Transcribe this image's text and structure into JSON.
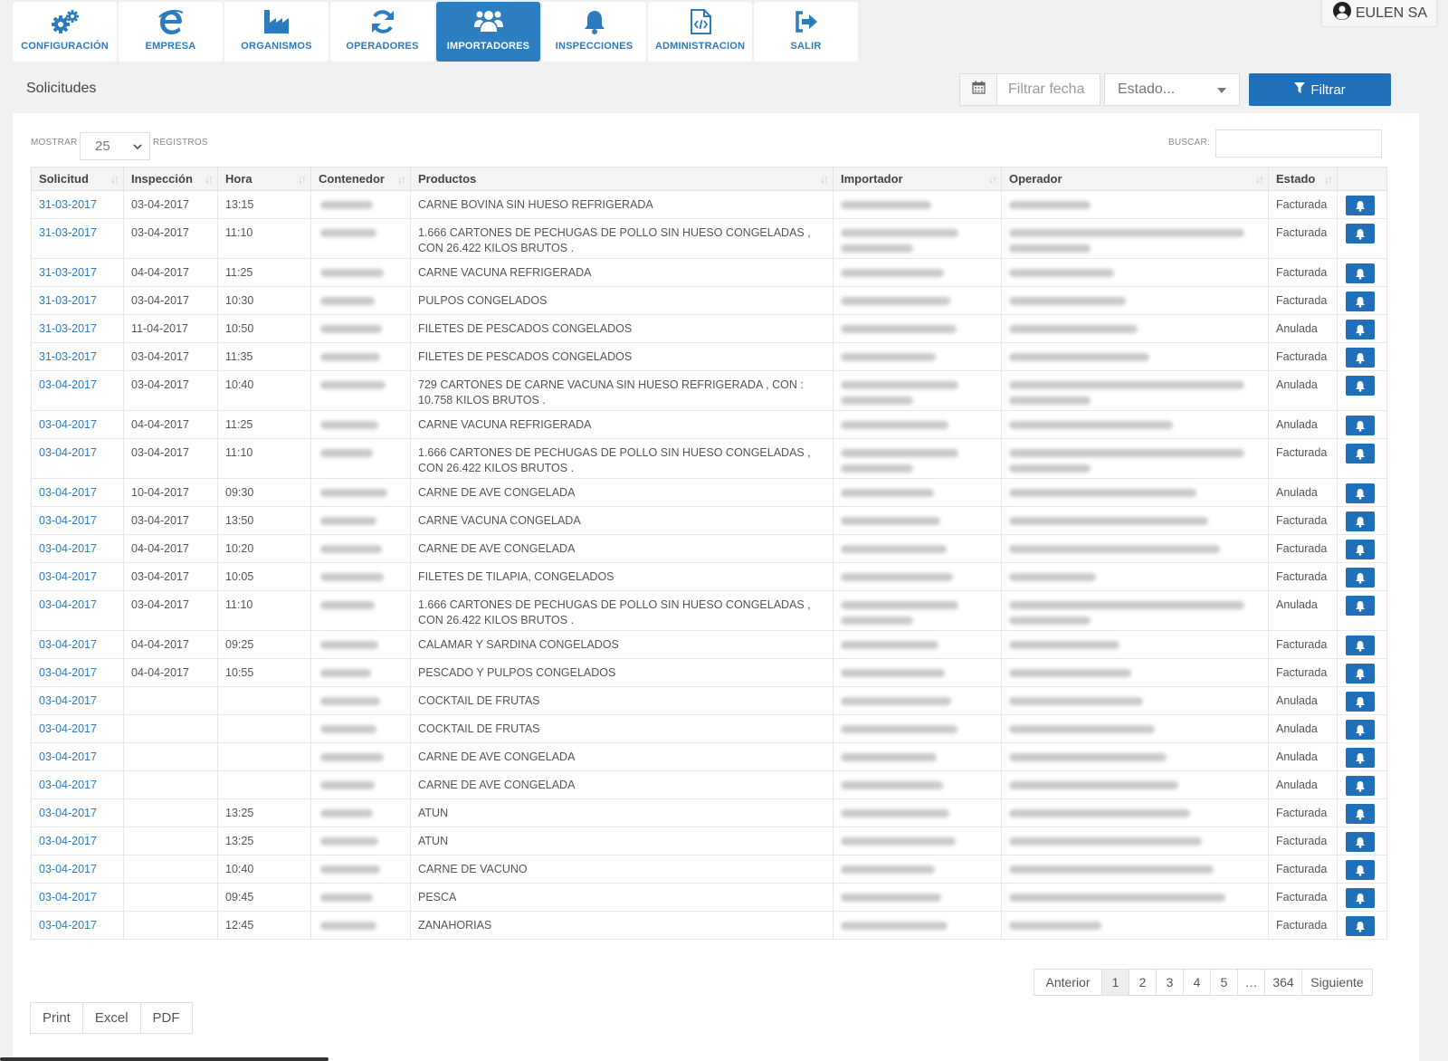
{
  "nav": [
    {
      "label": "CONFIGURACIÓN",
      "icon": "gears-icon"
    },
    {
      "label": "EMPRESA",
      "icon": "e-logo-icon"
    },
    {
      "label": "ORGANISMOS",
      "icon": "factory-icon"
    },
    {
      "label": "OPERADORES",
      "icon": "refresh-icon"
    },
    {
      "label": "IMPORTADORES",
      "icon": "users-icon",
      "active": true
    },
    {
      "label": "INSPECCIONES",
      "icon": "bell-icon"
    },
    {
      "label": "ADMINISTRACION",
      "icon": "code-file-icon"
    },
    {
      "label": "SALIR",
      "icon": "sign-out-icon"
    }
  ],
  "user": {
    "name": "EULEN SA"
  },
  "filters": {
    "title": "Solicitudes",
    "date_placeholder": "Filtrar fecha",
    "estado_placeholder": "Estado...",
    "filtrar_label": "Filtrar"
  },
  "table_controls": {
    "mostrar_label": "MOSTRAR",
    "page_size": "25",
    "registros_label": "REGISTROS",
    "buscar_label": "BUSCAR:"
  },
  "columns": [
    "Solicitud",
    "Inspección",
    "Hora",
    "Contenedor",
    "Productos",
    "Importador",
    "Operador",
    "Estado"
  ],
  "rows": [
    {
      "solicitud": "31-03-2017",
      "inspeccion": "03-04-2017",
      "hora": "13:15",
      "productos": "CARNE BOVINA SIN HUESO REFRIGERADA",
      "estado": "Facturada"
    },
    {
      "solicitud": "31-03-2017",
      "inspeccion": "03-04-2017",
      "hora": "11:10",
      "productos": "1.666 CARTONES DE PECHUGAS DE POLLO SIN HUESO CONGELADAS , CON 26.422 KILOS BRUTOS .",
      "estado": "Facturada"
    },
    {
      "solicitud": "31-03-2017",
      "inspeccion": "04-04-2017",
      "hora": "11:25",
      "productos": "CARNE VACUNA REFRIGERADA",
      "estado": "Facturada"
    },
    {
      "solicitud": "31-03-2017",
      "inspeccion": "03-04-2017",
      "hora": "10:30",
      "productos": "PULPOS CONGELADOS",
      "estado": "Facturada"
    },
    {
      "solicitud": "31-03-2017",
      "inspeccion": "11-04-2017",
      "hora": "10:50",
      "productos": "FILETES DE PESCADOS CONGELADOS",
      "estado": "Anulada"
    },
    {
      "solicitud": "31-03-2017",
      "inspeccion": "03-04-2017",
      "hora": "11:35",
      "productos": "FILETES DE PESCADOS CONGELADOS",
      "estado": "Facturada"
    },
    {
      "solicitud": "03-04-2017",
      "inspeccion": "03-04-2017",
      "hora": "10:40",
      "productos": "729 CARTONES DE CARNE VACUNA SIN HUESO REFRIGERADA , CON : 10.758 KILOS BRUTOS .",
      "estado": "Anulada"
    },
    {
      "solicitud": "03-04-2017",
      "inspeccion": "04-04-2017",
      "hora": "11:25",
      "productos": "CARNE VACUNA REFRIGERADA",
      "estado": "Anulada"
    },
    {
      "solicitud": "03-04-2017",
      "inspeccion": "03-04-2017",
      "hora": "11:10",
      "productos": "1.666 CARTONES DE PECHUGAS DE POLLO SIN HUESO CONGELADAS , CON 26.422 KILOS BRUTOS .",
      "estado": "Facturada"
    },
    {
      "solicitud": "03-04-2017",
      "inspeccion": "10-04-2017",
      "hora": "09:30",
      "productos": "CARNE DE AVE CONGELADA",
      "estado": "Anulada"
    },
    {
      "solicitud": "03-04-2017",
      "inspeccion": "03-04-2017",
      "hora": "13:50",
      "productos": "CARNE VACUNA CONGELADA",
      "estado": "Facturada"
    },
    {
      "solicitud": "03-04-2017",
      "inspeccion": "04-04-2017",
      "hora": "10:20",
      "productos": "CARNE DE AVE CONGELADA",
      "estado": "Facturada"
    },
    {
      "solicitud": "03-04-2017",
      "inspeccion": "03-04-2017",
      "hora": "10:05",
      "productos": "FILETES DE TILAPIA, CONGELADOS",
      "estado": "Facturada"
    },
    {
      "solicitud": "03-04-2017",
      "inspeccion": "03-04-2017",
      "hora": "11:10",
      "productos": "1.666 CARTONES DE PECHUGAS DE POLLO SIN HUESO CONGELADAS , CON 26.422 KILOS BRUTOS .",
      "estado": "Anulada"
    },
    {
      "solicitud": "03-04-2017",
      "inspeccion": "04-04-2017",
      "hora": "09:25",
      "productos": "CALAMAR Y SARDINA CONGELADOS",
      "estado": "Facturada"
    },
    {
      "solicitud": "03-04-2017",
      "inspeccion": "04-04-2017",
      "hora": "10:55",
      "productos": "PESCADO Y PULPOS CONGELADOS",
      "estado": "Facturada"
    },
    {
      "solicitud": "03-04-2017",
      "inspeccion": "",
      "hora": "",
      "productos": "COCKTAIL DE FRUTAS",
      "estado": "Anulada"
    },
    {
      "solicitud": "03-04-2017",
      "inspeccion": "",
      "hora": "",
      "productos": "COCKTAIL DE FRUTAS",
      "estado": "Anulada"
    },
    {
      "solicitud": "03-04-2017",
      "inspeccion": "",
      "hora": "",
      "productos": "CARNE DE AVE CONGELADA",
      "estado": "Anulada"
    },
    {
      "solicitud": "03-04-2017",
      "inspeccion": "",
      "hora": "",
      "productos": "CARNE DE AVE CONGELADA",
      "estado": "Anulada"
    },
    {
      "solicitud": "03-04-2017",
      "inspeccion": "",
      "hora": "13:25",
      "productos": "ATUN",
      "estado": "Facturada"
    },
    {
      "solicitud": "03-04-2017",
      "inspeccion": "",
      "hora": "13:25",
      "productos": "ATUN",
      "estado": "Facturada"
    },
    {
      "solicitud": "03-04-2017",
      "inspeccion": "",
      "hora": "10:40",
      "productos": "CARNE DE VACUNO",
      "estado": "Facturada"
    },
    {
      "solicitud": "03-04-2017",
      "inspeccion": "",
      "hora": "09:45",
      "productos": "PESCA",
      "estado": "Facturada"
    },
    {
      "solicitud": "03-04-2017",
      "inspeccion": "",
      "hora": "12:45",
      "productos": "ZANAHORIAS",
      "estado": "Facturada"
    }
  ],
  "pagination": {
    "prev": "Anterior",
    "pages": [
      "1",
      "2",
      "3",
      "4",
      "5",
      "…",
      "364"
    ],
    "next": "Siguiente"
  },
  "exports": [
    "Print",
    "Excel",
    "PDF"
  ],
  "colors": {
    "accent": "#2d7dc1",
    "button": "#1f6fb9",
    "link": "#2b7bbd"
  }
}
